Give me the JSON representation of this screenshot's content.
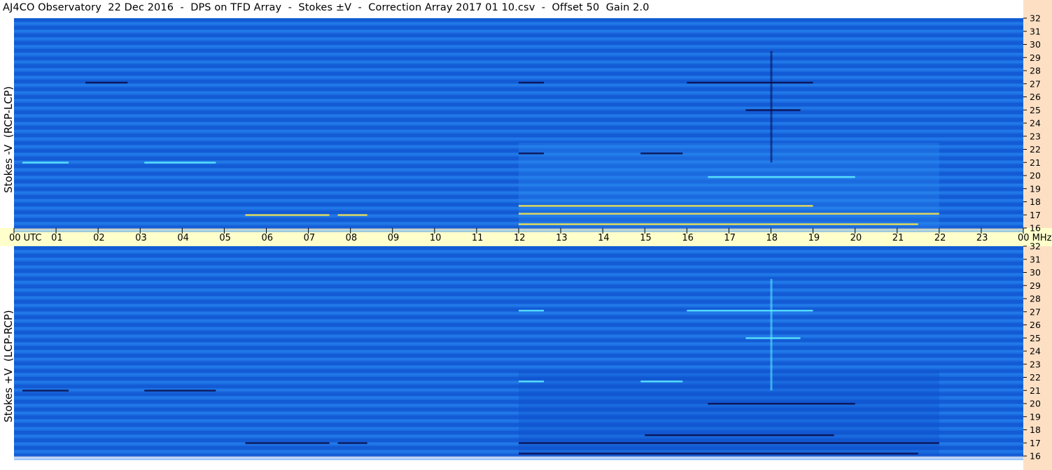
{
  "title": "AJ4CO Observatory  22 Dec 2016  -  DPS on TFD Array  -  Stokes ±V  -  Correction Array 2017 01 10.csv  -  Offset 50  Gain 2.0",
  "colors": {
    "background_blue": "#1a6be0",
    "dark_band": "#0f4fcc",
    "light_band": "#2a8af0",
    "cyan_emission": "#5ff0ff",
    "yellow_emission": "#ffe94a",
    "black_emission": "#0a0a4a",
    "timebar": "#ffffcc",
    "freq_strip": "#fde0c4"
  },
  "chart_data": [
    {
      "type": "heatmap",
      "name": "top-spectrogram",
      "ylabel": "Stokes -V  (RCP-LCP)",
      "x_ticks": [
        "00 UTC",
        "01",
        "02",
        "03",
        "04",
        "05",
        "06",
        "07",
        "08",
        "09",
        "10",
        "11",
        "12",
        "13",
        "14",
        "15",
        "16",
        "17",
        "18",
        "19",
        "20",
        "21",
        "22",
        "23",
        "00 MHz"
      ],
      "xlim": [
        0,
        24
      ],
      "xunit": "hours UTC",
      "y_ticks": [
        "16",
        "17",
        "18",
        "19",
        "20",
        "21",
        "22",
        "23",
        "24",
        "25",
        "26",
        "27",
        "28",
        "29",
        "30",
        "31",
        "32"
      ],
      "ylim": [
        16,
        32
      ],
      "yunit": "MHz",
      "emission_lines": [
        {
          "t0": 5.5,
          "t1": 7.5,
          "f": 17.0,
          "color": "yellow"
        },
        {
          "t0": 7.7,
          "t1": 8.4,
          "f": 17.0,
          "color": "yellow"
        },
        {
          "t0": 12.0,
          "t1": 19.0,
          "f": 17.7,
          "color": "yellow"
        },
        {
          "t0": 12.0,
          "t1": 22.0,
          "f": 17.1,
          "color": "yellow"
        },
        {
          "t0": 12.0,
          "t1": 21.5,
          "f": 16.3,
          "color": "yellow"
        },
        {
          "t0": 16.5,
          "t1": 20.0,
          "f": 19.9,
          "color": "cyan"
        },
        {
          "t0": 0.2,
          "t1": 1.3,
          "f": 21.0,
          "color": "cyan"
        },
        {
          "t0": 3.1,
          "t1": 4.8,
          "f": 21.0,
          "color": "cyan"
        },
        {
          "t0": 12.0,
          "t1": 12.6,
          "f": 21.7,
          "color": "black"
        },
        {
          "t0": 14.9,
          "t1": 15.9,
          "f": 21.7,
          "color": "black"
        },
        {
          "t0": 17.4,
          "t1": 18.7,
          "f": 25.0,
          "color": "black"
        },
        {
          "t0": 12.0,
          "t1": 12.6,
          "f": 27.1,
          "color": "black"
        },
        {
          "t0": 16.0,
          "t1": 19.0,
          "f": 27.1,
          "color": "black"
        },
        {
          "t0": 1.7,
          "t1": 2.7,
          "f": 27.1,
          "color": "black"
        }
      ]
    },
    {
      "type": "heatmap",
      "name": "bottom-spectrogram",
      "ylabel": "Stokes +V  (LCP-RCP)",
      "x_ticks": [
        "00 UTC",
        "01",
        "02",
        "03",
        "04",
        "05",
        "06",
        "07",
        "08",
        "09",
        "10",
        "11",
        "12",
        "13",
        "14",
        "15",
        "16",
        "17",
        "18",
        "19",
        "20",
        "21",
        "22",
        "23",
        "00 MHz"
      ],
      "xlim": [
        0,
        24
      ],
      "xunit": "hours UTC",
      "y_ticks": [
        "16",
        "17",
        "18",
        "19",
        "20",
        "21",
        "22",
        "23",
        "24",
        "25",
        "26",
        "27",
        "28",
        "29",
        "30",
        "31",
        "32"
      ],
      "ylim": [
        16,
        32
      ],
      "yunit": "MHz",
      "emission_lines": [
        {
          "t0": 5.5,
          "t1": 7.5,
          "f": 17.0,
          "color": "black"
        },
        {
          "t0": 7.7,
          "t1": 8.4,
          "f": 17.0,
          "color": "black"
        },
        {
          "t0": 12.0,
          "t1": 22.0,
          "f": 17.0,
          "color": "black"
        },
        {
          "t0": 15.0,
          "t1": 19.5,
          "f": 17.6,
          "color": "black"
        },
        {
          "t0": 12.0,
          "t1": 21.5,
          "f": 16.2,
          "color": "black"
        },
        {
          "t0": 16.5,
          "t1": 20.0,
          "f": 20.0,
          "color": "black"
        },
        {
          "t0": 0.2,
          "t1": 1.3,
          "f": 21.0,
          "color": "black"
        },
        {
          "t0": 3.1,
          "t1": 4.8,
          "f": 21.0,
          "color": "black"
        },
        {
          "t0": 12.0,
          "t1": 12.6,
          "f": 21.7,
          "color": "cyan"
        },
        {
          "t0": 14.9,
          "t1": 15.9,
          "f": 21.7,
          "color": "cyan"
        },
        {
          "t0": 17.4,
          "t1": 18.7,
          "f": 25.0,
          "color": "cyan"
        },
        {
          "t0": 12.0,
          "t1": 12.6,
          "f": 27.1,
          "color": "cyan"
        },
        {
          "t0": 16.0,
          "t1": 19.0,
          "f": 27.1,
          "color": "cyan"
        }
      ]
    }
  ]
}
